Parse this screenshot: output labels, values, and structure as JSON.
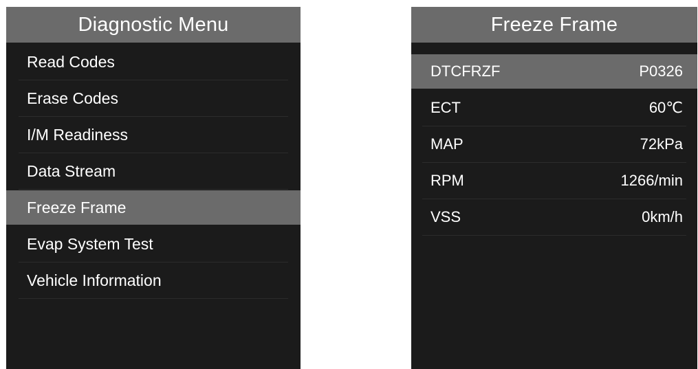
{
  "left_screen": {
    "title": "Diagnostic Menu",
    "items": [
      {
        "label": "Read Codes"
      },
      {
        "label": "Erase Codes"
      },
      {
        "label": "I/M Readiness"
      },
      {
        "label": "Data Stream"
      },
      {
        "label": "Freeze Frame",
        "selected": true
      },
      {
        "label": "Evap System Test"
      },
      {
        "label": "Vehicle Information"
      }
    ]
  },
  "right_screen": {
    "title": "Freeze Frame",
    "rows": [
      {
        "name": "DTCFRZF",
        "value": "P0326",
        "highlighted": true
      },
      {
        "name": "ECT",
        "value": "60℃"
      },
      {
        "name": "MAP",
        "value": "72kPa"
      },
      {
        "name": "RPM",
        "value": "1266/min"
      },
      {
        "name": "VSS",
        "value": "0km/h"
      }
    ]
  },
  "colors": {
    "screen_background": "#1b1b1b",
    "title_bar": "#6b6b6b",
    "selection": "#6b6b6b",
    "text": "#ffffff"
  }
}
